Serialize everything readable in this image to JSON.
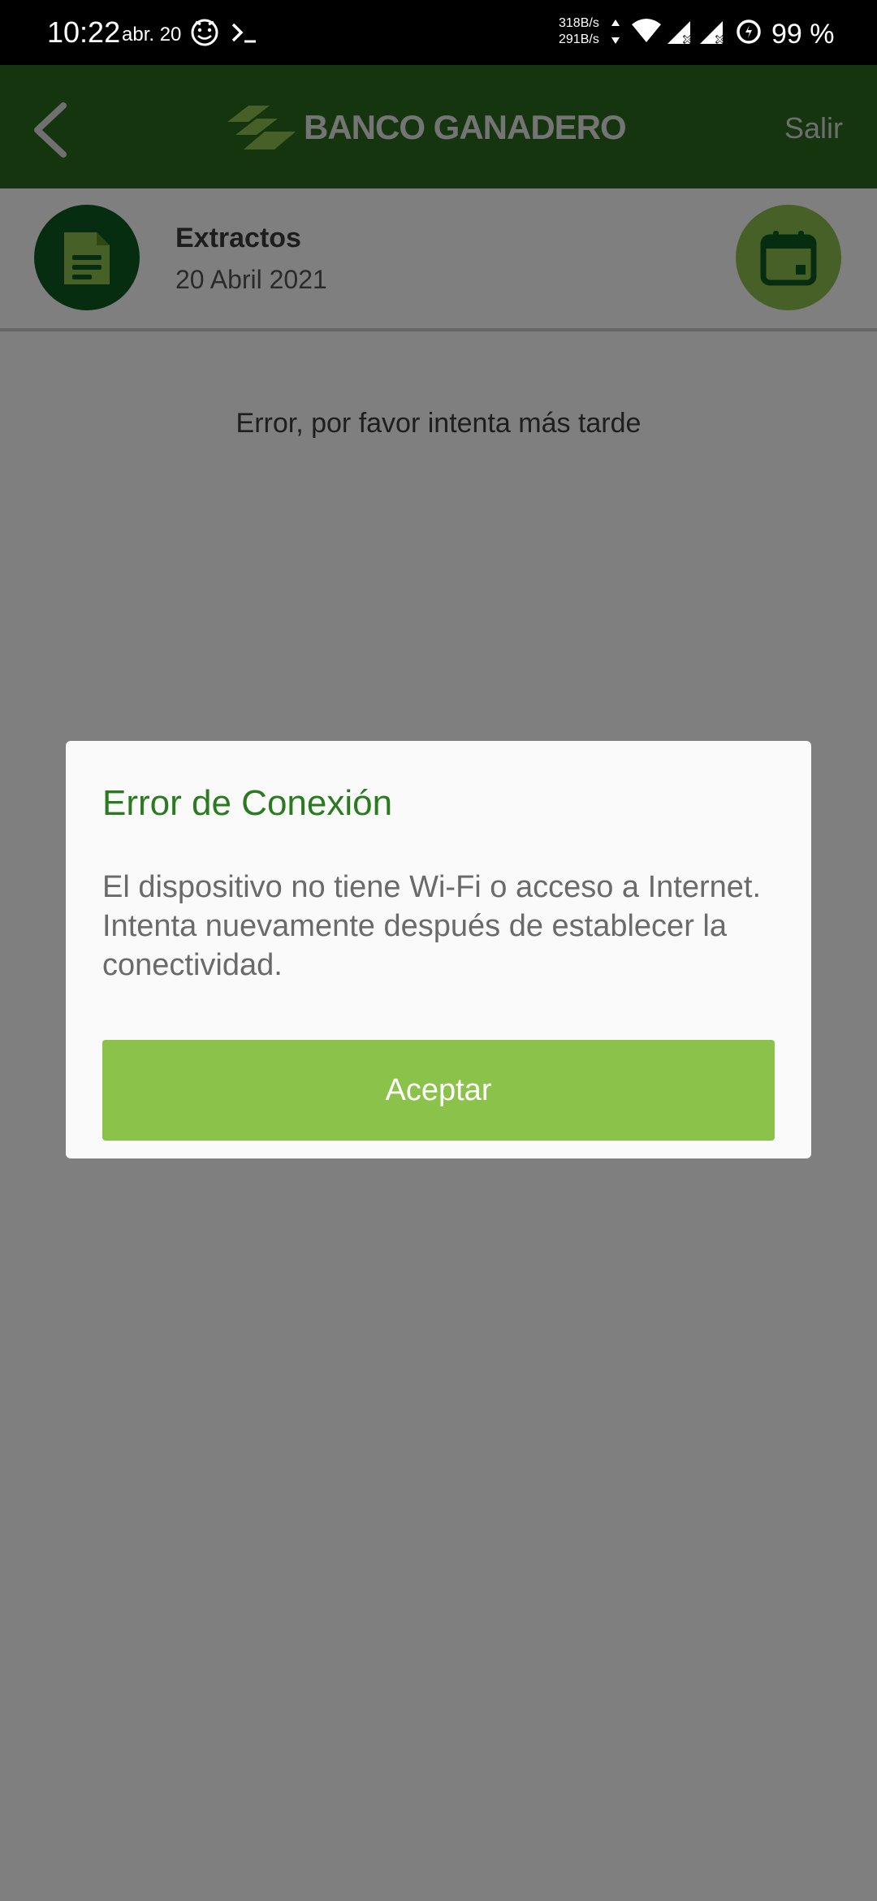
{
  "status_bar": {
    "time": "10:22",
    "date": "abr. 20",
    "netspeed_up": "318B/s",
    "netspeed_down": "291B/s",
    "battery": "99 %",
    "icons": [
      "face-icon",
      "terminal-icon",
      "wifi-icon",
      "signal-icon",
      "signal-icon",
      "battery-saver-icon"
    ]
  },
  "header": {
    "logo_text": "BANCO GANADERO",
    "logout_label": "Salir",
    "back_icon": "chevron-left-icon",
    "background": "#2b6a1f"
  },
  "info_bar": {
    "title": "Extractos",
    "date": "20 Abril 2021",
    "doc_icon": "document-icon",
    "calendar_icon": "calendar-icon"
  },
  "content": {
    "error_text": "Error, por favor intenta más tarde"
  },
  "dialog": {
    "title": "Error de Conexión",
    "message": "El dispositivo no tiene Wi-Fi o acceso a Internet. Intenta nuevamente después de establecer la conectividad.",
    "button_label": "Aceptar",
    "title_color": "#2a7a1f",
    "button_color": "#8bc34a"
  }
}
